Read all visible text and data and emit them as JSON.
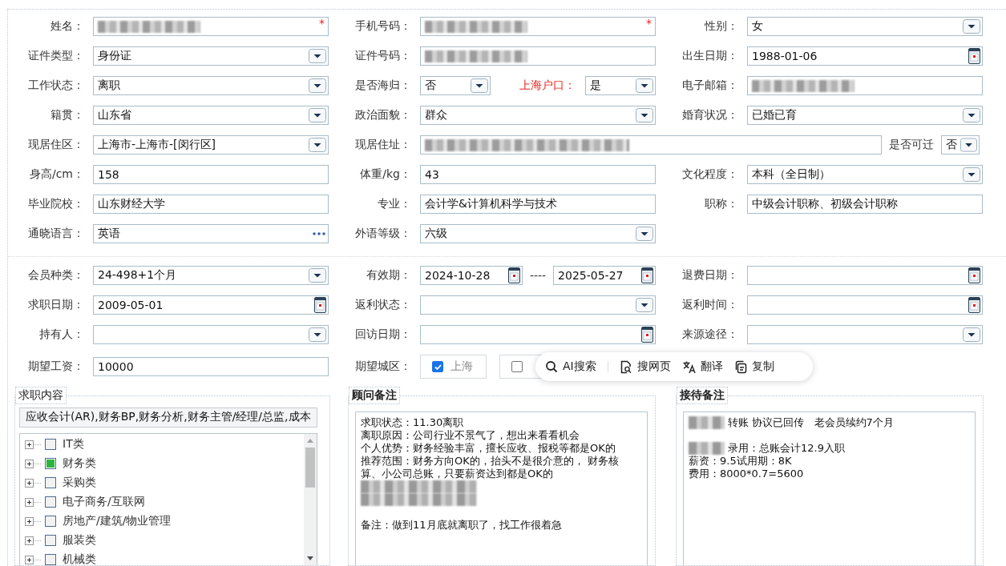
{
  "sections": [
    {
      "rows": [
        {
          "cells": [
            {
              "kind": "normal",
              "label": "姓名：",
              "fields": [
                {
                  "kind": "text",
                  "redacted": true,
                  "marker": "*"
                }
              ]
            },
            {
              "kind": "normal",
              "label": "手机号码：",
              "fields": [
                {
                  "kind": "text",
                  "redacted": true,
                  "marker": "*"
                }
              ]
            },
            {
              "kind": "normal",
              "label": "性别：",
              "fields": [
                {
                  "kind": "select",
                  "value": "女"
                }
              ]
            }
          ]
        },
        {
          "cells": [
            {
              "kind": "normal",
              "label": "证件类型：",
              "fields": [
                {
                  "kind": "select",
                  "value": "身份证"
                }
              ]
            },
            {
              "kind": "normal",
              "label": "证件号码：",
              "fields": [
                {
                  "kind": "text",
                  "redacted": true
                }
              ]
            },
            {
              "kind": "normal",
              "label": "出生日期：",
              "fields": [
                {
                  "kind": "date",
                  "value": "1988-01-06"
                }
              ]
            }
          ]
        },
        {
          "cells": [
            {
              "kind": "normal",
              "label": "工作状态：",
              "fields": [
                {
                  "kind": "select",
                  "value": "离职"
                }
              ]
            },
            {
              "kind": "normal",
              "label": "是否海归：",
              "fields": [
                {
                  "kind": "mini-select",
                  "value": "否"
                },
                {
                  "kind": "label",
                  "text": "上海户口：",
                  "highlight": true
                },
                {
                  "kind": "mini-select",
                  "value": "是"
                }
              ]
            },
            {
              "kind": "normal",
              "label": "电子邮箱：",
              "fields": [
                {
                  "kind": "text",
                  "redacted": true
                }
              ]
            }
          ]
        },
        {
          "cells": [
            {
              "kind": "normal",
              "label": "籍贯：",
              "fields": [
                {
                  "kind": "select",
                  "value": "山东省"
                }
              ]
            },
            {
              "kind": "normal",
              "label": "政治面貌：",
              "fields": [
                {
                  "kind": "select",
                  "value": "群众"
                }
              ]
            },
            {
              "kind": "normal",
              "label": "婚育状况：",
              "fields": [
                {
                  "kind": "select",
                  "value": "已婚已育"
                }
              ]
            }
          ]
        },
        {
          "cells": [
            {
              "kind": "normal",
              "label": "现居住区：",
              "fields": [
                {
                  "kind": "select",
                  "value": "上海市-上海市-[闵行区]"
                }
              ]
            },
            {
              "kind": "wide",
              "label": "现居住址：",
              "fields": [
                {
                  "kind": "text",
                  "redacted": true
                },
                {
                  "kind": "label",
                  "text": "是否可迁",
                  "highlight": false
                },
                {
                  "kind": "mini-select",
                  "value": "否"
                }
              ]
            }
          ]
        },
        {
          "cells": [
            {
              "kind": "normal",
              "label": "身高/cm：",
              "fields": [
                {
                  "kind": "text",
                  "value": "158"
                }
              ]
            },
            {
              "kind": "normal",
              "label": "体重/kg：",
              "fields": [
                {
                  "kind": "text",
                  "value": "43"
                }
              ]
            },
            {
              "kind": "normal",
              "label": "文化程度：",
              "fields": [
                {
                  "kind": "select",
                  "value": "本科（全日制）"
                }
              ]
            }
          ]
        },
        {
          "cells": [
            {
              "kind": "normal",
              "label": "毕业院校：",
              "fields": [
                {
                  "kind": "text",
                  "value": "山东财经大学"
                }
              ]
            },
            {
              "kind": "normal",
              "label": "专业：",
              "fields": [
                {
                  "kind": "text",
                  "value": "会计学&计算机科学与技术"
                }
              ]
            },
            {
              "kind": "normal",
              "label": "职称：",
              "fields": [
                {
                  "kind": "text",
                  "value": "中级会计职称、初级会计职称"
                }
              ]
            }
          ]
        },
        {
          "cells": [
            {
              "kind": "normal",
              "label": "通晓语言：",
              "fields": [
                {
                  "kind": "picker",
                  "value": "英语"
                }
              ]
            },
            {
              "kind": "normal",
              "label": "外语等级：",
              "fields": [
                {
                  "kind": "select",
                  "value": "六级"
                }
              ]
            }
          ]
        }
      ]
    },
    {
      "rows": [
        {
          "cells": [
            {
              "kind": "normal",
              "label": "会员种类：",
              "fields": [
                {
                  "kind": "select",
                  "value": "24-498+1个月"
                }
              ]
            },
            {
              "kind": "normal",
              "label": "有效期：",
              "fields": [
                {
                  "kind": "date",
                  "value": "2024-10-28"
                },
                {
                  "kind": "label",
                  "text": "----",
                  "highlight": false
                },
                {
                  "kind": "date",
                  "value": "2025-05-27"
                }
              ]
            },
            {
              "kind": "normal",
              "label": "退费日期：",
              "fields": [
                {
                  "kind": "date"
                }
              ]
            }
          ]
        },
        {
          "cells": [
            {
              "kind": "normal",
              "label": "求职日期：",
              "fields": [
                {
                  "kind": "date",
                  "value": "2009-05-01"
                }
              ]
            },
            {
              "kind": "normal",
              "label": "返利状态：",
              "fields": [
                {
                  "kind": "select"
                }
              ]
            },
            {
              "kind": "normal",
              "label": "返利时间：",
              "fields": [
                {
                  "kind": "date"
                }
              ]
            }
          ]
        },
        {
          "cells": [
            {
              "kind": "normal",
              "label": "持有人：",
              "fields": [
                {
                  "kind": "select"
                }
              ]
            },
            {
              "kind": "normal",
              "label": "回访日期：",
              "fields": [
                {
                  "kind": "date"
                }
              ]
            },
            {
              "kind": "normal",
              "label": "来源途径：",
              "fields": [
                {
                  "kind": "select"
                }
              ]
            }
          ]
        },
        {
          "cells": [
            {
              "kind": "normal",
              "label": "期望工资：",
              "fields": [
                {
                  "kind": "text",
                  "value": "10000"
                }
              ]
            },
            {
              "kind": "normal",
              "label": "期望城区：",
              "fields": [
                {
                  "kind": "check",
                  "text": "上海",
                  "checked": true
                },
                {
                  "kind": "check",
                  "checked": false
                }
              ]
            }
          ]
        }
      ]
    }
  ],
  "panels": [
    {
      "kind": "tree",
      "title": "求职内容",
      "emphasized": false,
      "summary": "应收会计(AR),财务BP,财务分析,财务主管/经理/总监,成本",
      "items": [
        {
          "label": "IT类",
          "partial": false
        },
        {
          "label": "财务类",
          "partial": true
        },
        {
          "label": "采购类",
          "partial": false
        },
        {
          "label": "电子商务/互联网",
          "partial": false
        },
        {
          "label": "房地产/建筑/物业管理",
          "partial": false
        },
        {
          "label": "服装类",
          "partial": false
        },
        {
          "label": "机械类",
          "partial": false
        }
      ]
    },
    {
      "kind": "notes",
      "title": "顾问备注",
      "emphasized": true,
      "lines": [
        {
          "kind": "text",
          "text": "求职状态：11.30离职",
          "redacted_prefix": false
        },
        {
          "kind": "text",
          "text": "离职原因：公司行业不景气了，想出来看看机会",
          "redacted_prefix": false
        },
        {
          "kind": "text",
          "text": "个人优势：财务经验丰富，擅长应收、报税等都是OK的",
          "redacted_prefix": false
        },
        {
          "kind": "text",
          "text": "推荐范围：财务方向OK的，抬头不是很介意的， 财务核",
          "redacted_prefix": false
        },
        {
          "kind": "text",
          "text": "算、小公司总账，只要薪资达到都是OK的",
          "redacted_prefix": false
        },
        {
          "kind": "redacted"
        },
        {
          "kind": "redacted"
        },
        {
          "kind": "blank"
        },
        {
          "kind": "text",
          "text": "备注：做到11月底就离职了，找工作很着急",
          "redacted_prefix": false
        }
      ]
    },
    {
      "kind": "notes",
      "title": "接待备注",
      "emphasized": true,
      "lines": [
        {
          "kind": "text",
          "text": "转账 协议已回传   老会员续约7个月",
          "redacted_prefix": true
        },
        {
          "kind": "blank"
        },
        {
          "kind": "text",
          "text": "录用：总账会计12.9入职",
          "redacted_prefix": true
        },
        {
          "kind": "text",
          "text": "薪资：9.5试用期：8K",
          "redacted_prefix": false
        },
        {
          "kind": "text",
          "text": "费用：8000*0.7=5600",
          "redacted_prefix": false
        }
      ]
    }
  ],
  "popup": {
    "items": [
      {
        "kind": "search",
        "label": "AI搜索"
      },
      {
        "kind": "separator"
      },
      {
        "kind": "page",
        "label": "搜网页"
      },
      {
        "kind": "translate",
        "label": "翻译"
      },
      {
        "kind": "copy",
        "label": "复制"
      }
    ]
  }
}
